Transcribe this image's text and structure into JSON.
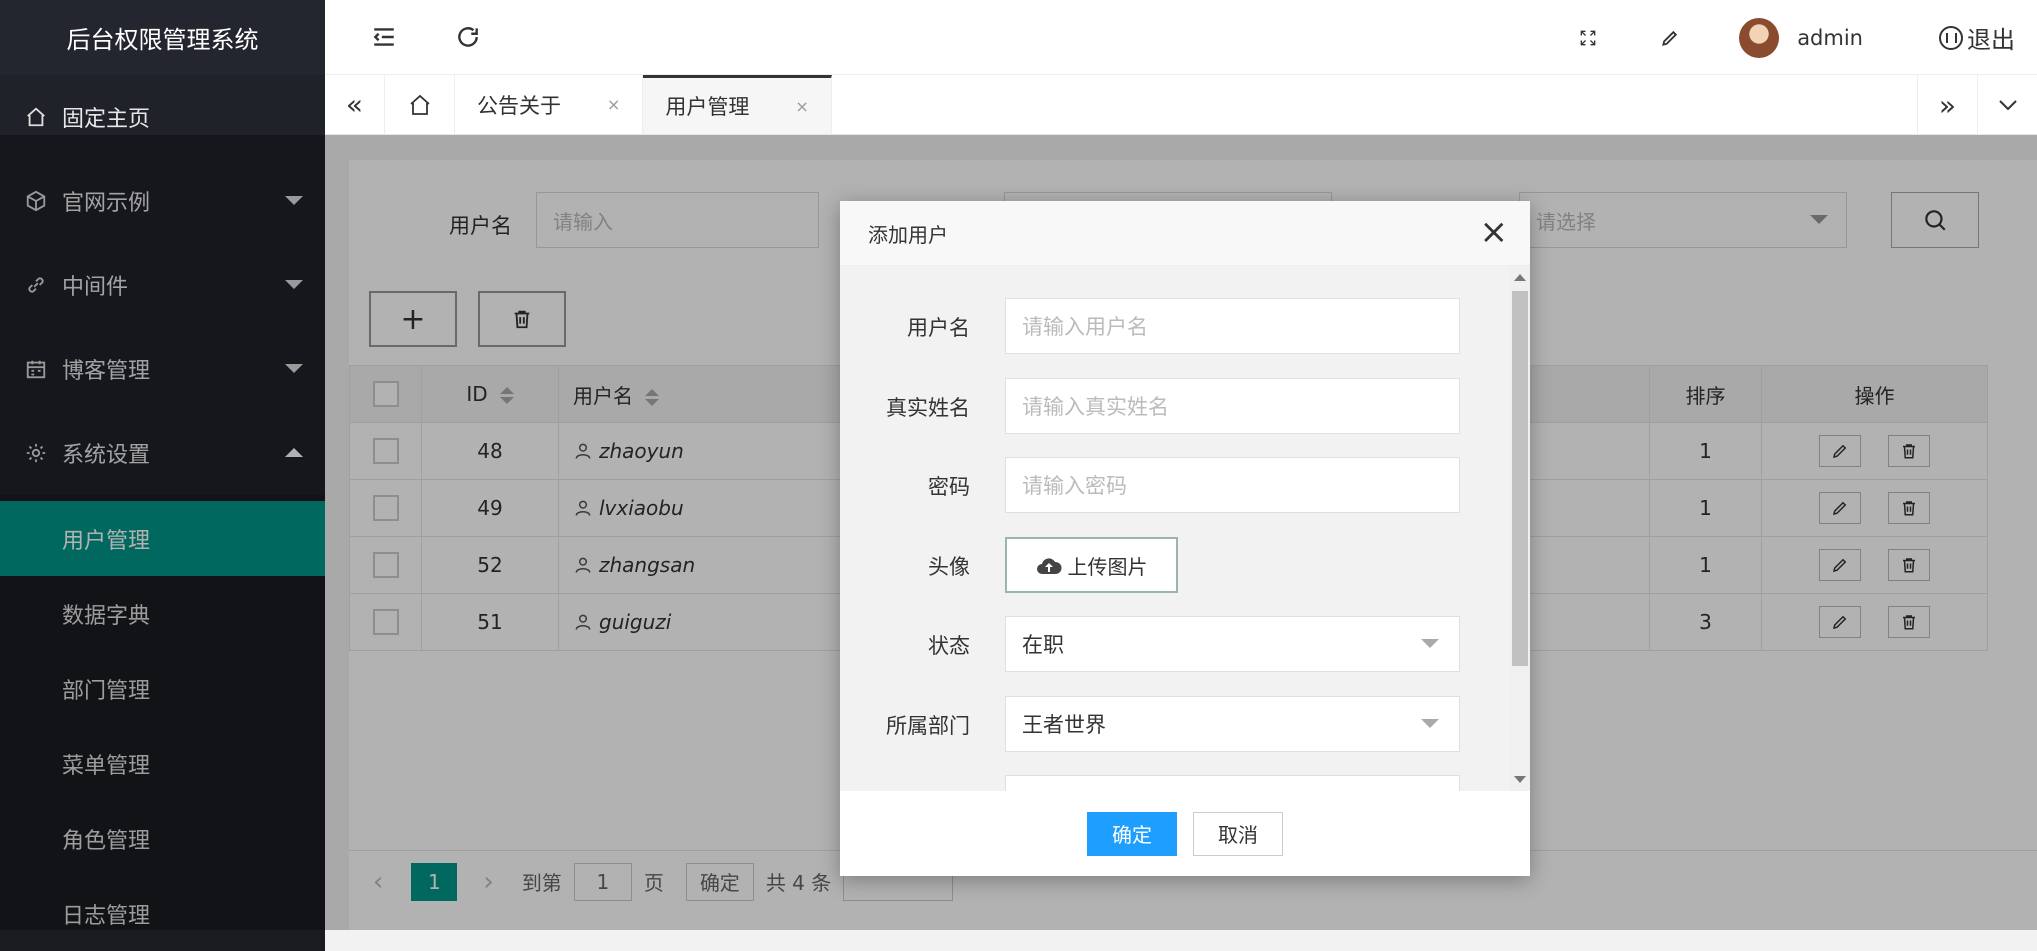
{
  "sidebar": {
    "logo": "后台权限管理系统",
    "items": [
      {
        "label": "固定主页"
      },
      {
        "label": "官网示例"
      },
      {
        "label": "中间件"
      },
      {
        "label": "博客管理"
      },
      {
        "label": "系统设置"
      }
    ],
    "submenu": [
      {
        "label": "用户管理"
      },
      {
        "label": "数据字典"
      },
      {
        "label": "部门管理"
      },
      {
        "label": "菜单管理"
      },
      {
        "label": "角色管理"
      },
      {
        "label": "日志管理"
      }
    ]
  },
  "header": {
    "user": "admin",
    "logout": "退出"
  },
  "tabs": [
    {
      "label": "公告关于",
      "close": "×"
    },
    {
      "label": "用户管理",
      "close": "×"
    }
  ],
  "search": {
    "username_label": "用户名",
    "username_placeholder": "请输入",
    "select_placeholder": "请选择"
  },
  "table": {
    "headers": [
      "ID",
      "用户名",
      "排序",
      "操作"
    ],
    "rows": [
      {
        "id": "48",
        "username": "zhaoyun",
        "sort": "1"
      },
      {
        "id": "49",
        "username": "lvxiaobu",
        "sort": "1"
      },
      {
        "id": "52",
        "username": "zhangsan",
        "sort": "1"
      },
      {
        "id": "51",
        "username": "guiguzi",
        "sort": "3"
      }
    ]
  },
  "pager": {
    "current": "1",
    "goto_label": "到第",
    "goto_value": "1",
    "page_unit": "页",
    "confirm": "确定",
    "total": "共 4 条"
  },
  "dialog": {
    "title": "添加用户",
    "close": "×",
    "fields": {
      "username_label": "用户名",
      "username_placeholder": "请输入用户名",
      "realname_label": "真实姓名",
      "realname_placeholder": "请输入真实姓名",
      "password_label": "密码",
      "password_placeholder": "请输入密码",
      "avatar_label": "头像",
      "upload_label": "上传图片",
      "status_label": "状态",
      "status_value": "在职",
      "dept_label": "所属部门",
      "dept_value": "王者世界"
    },
    "ok": "确定",
    "cancel": "取消"
  },
  "colors": {
    "sidebar_bg": "#20222a",
    "active": "#009688",
    "primary_button": "#1e9fff"
  }
}
